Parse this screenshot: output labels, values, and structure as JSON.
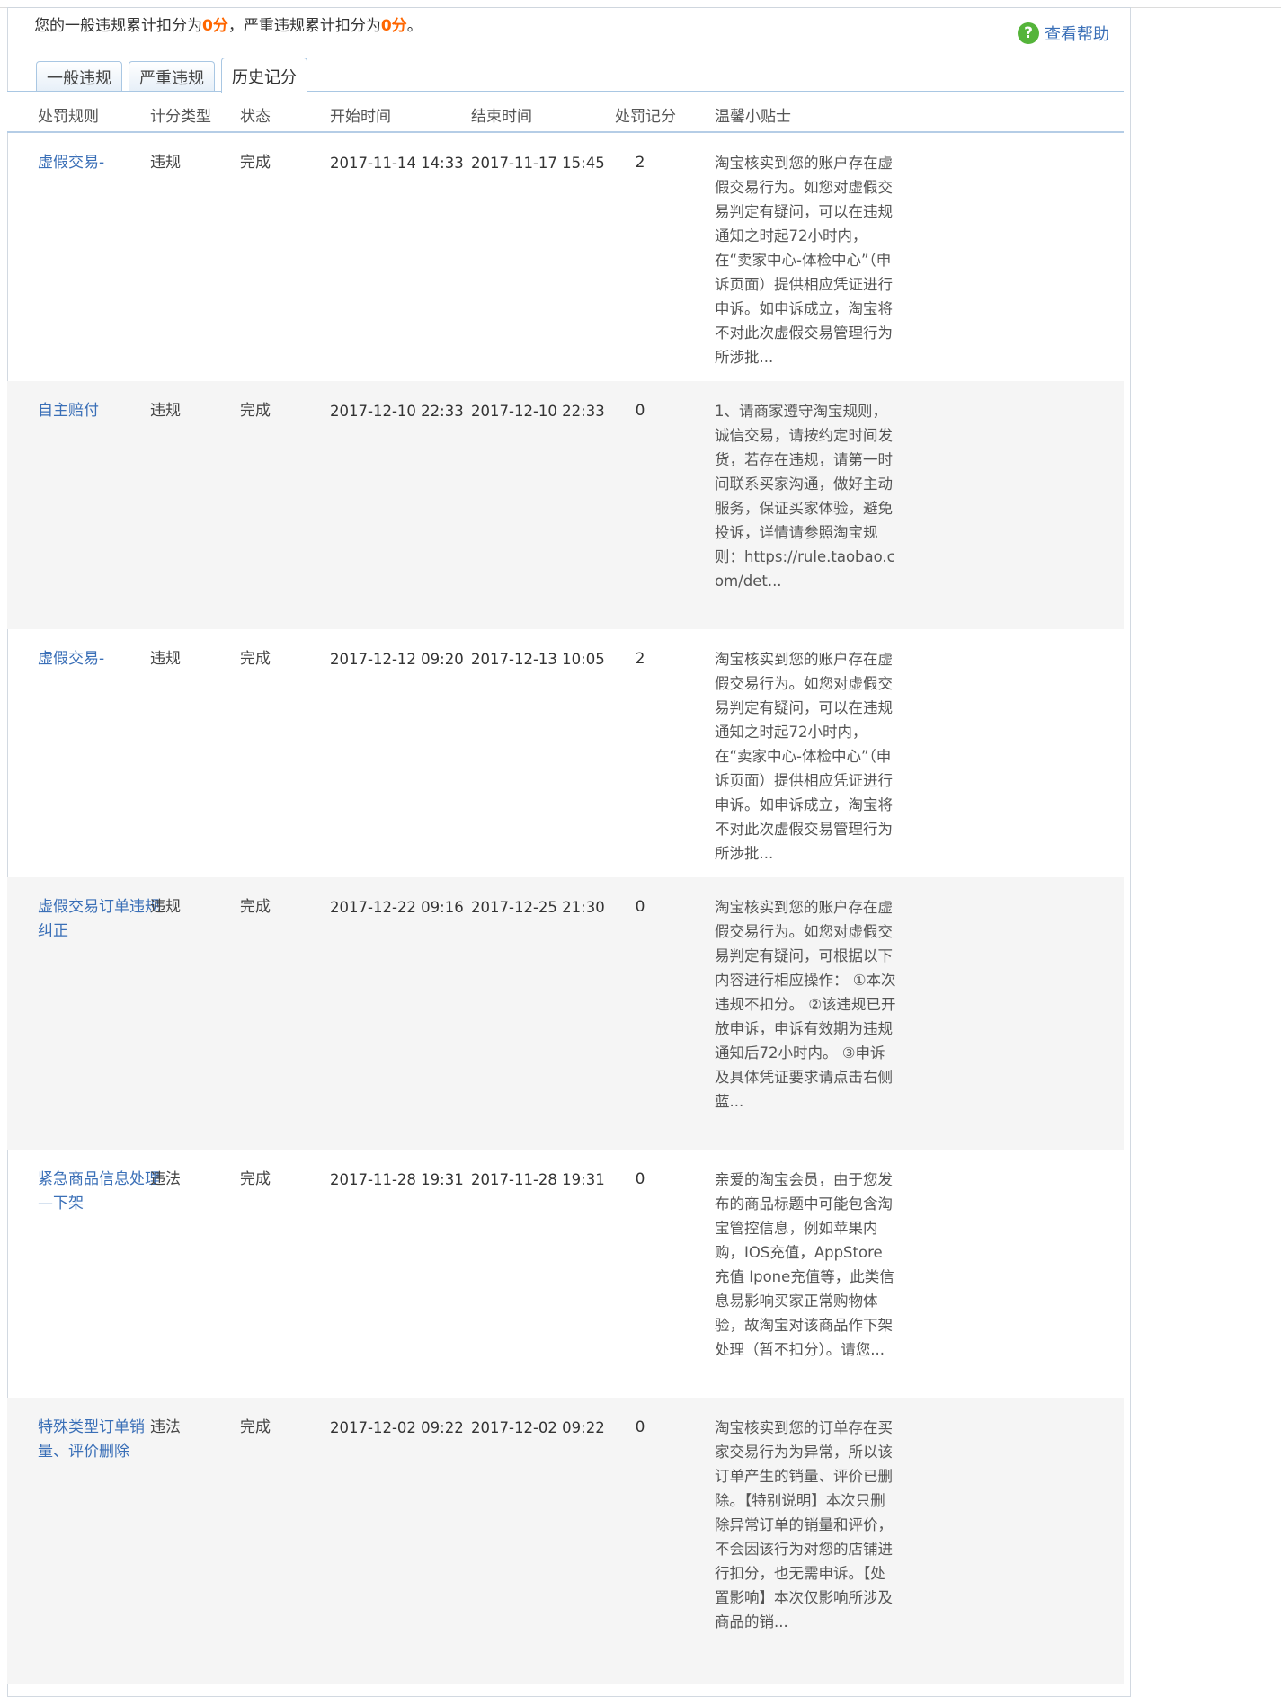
{
  "summary": {
    "prefix": "您的一般违规累计扣分为",
    "general_points": "0分",
    "middle": "，严重违规累计扣分为",
    "serious_points": "0分",
    "suffix": "。"
  },
  "help": {
    "label": "查看帮助",
    "icon": "help-question-icon",
    "icon_color": "#55b43a"
  },
  "tabs": [
    {
      "label": "一般违规",
      "active": false
    },
    {
      "label": "严重违规",
      "active": false
    },
    {
      "label": "历史记分",
      "active": true
    }
  ],
  "columns": [
    "处罚规则",
    "计分类型",
    "状态",
    "开始时间",
    "结束时间",
    "处罚记分",
    "温馨小贴士"
  ],
  "rows": [
    {
      "rule": "虚假交易-",
      "type": "违规",
      "status": "完成",
      "start": "2017-11-14 14:33",
      "end": "2017-11-17 15:45",
      "points": "2",
      "tip": "淘宝核实到您的账户存在虚假交易行为。如您对虚假交易判定有疑问，可以在违规通知之时起72小时内，在“卖家中心-体检中心”（申诉页面）提供相应凭证进行申诉。如申诉成立，淘宝将不对此次虚假交易管理行为所涉批..."
    },
    {
      "rule": "自主赔付",
      "type": "违规",
      "status": "完成",
      "start": "2017-12-10 22:33",
      "end": "2017-12-10 22:33",
      "points": "0",
      "tip": "1、请商家遵守淘宝规则，诚信交易，请按约定时间发货，若存在违规，请第一时间联系买家沟通，做好主动服务，保证买家体验，避免投诉，详情请参照淘宝规则：https://rule.taobao.com/det..."
    },
    {
      "rule": "虚假交易-",
      "type": "违规",
      "status": "完成",
      "start": "2017-12-12 09:20",
      "end": "2017-12-13 10:05",
      "points": "2",
      "tip": "淘宝核实到您的账户存在虚假交易行为。如您对虚假交易判定有疑问，可以在违规通知之时起72小时内，在“卖家中心-体检中心”（申诉页面）提供相应凭证进行申诉。如申诉成立，淘宝将不对此次虚假交易管理行为所涉批..."
    },
    {
      "rule": "虚假交易订单违规纠正",
      "type": "违规",
      "status": "完成",
      "start": "2017-12-22 09:16",
      "end": "2017-12-25 21:30",
      "points": "0",
      "tip": "淘宝核实到您的账户存在虚假交易行为。如您对虚假交易判定有疑问，可根据以下内容进行相应操作： ①本次违规不扣分。 ②该违规已开放申诉，申诉有效期为违规通知后72小时内。 ③申诉及具体凭证要求请点击右侧蓝..."
    },
    {
      "rule": "紧急商品信息处理—下架",
      "type": "违法",
      "status": "完成",
      "start": "2017-11-28 19:31",
      "end": "2017-11-28 19:31",
      "points": "0",
      "tip": "亲爱的淘宝会员，由于您发布的商品标题中可能包含淘宝管控信息，例如苹果内购，IOS充值，AppStore充值 Ipone充值等，此类信息易影响买家正常购物体验，故淘宝对该商品作下架处理（暂不扣分）。请您..."
    },
    {
      "rule": "特殊类型订单销量、评价删除",
      "type": "违法",
      "status": "完成",
      "start": "2017-12-02 09:22",
      "end": "2017-12-02 09:22",
      "points": "0",
      "tip": "淘宝核实到您的订单存在买家交易行为为异常，所以该订单产生的销量、评价已删除。【特别说明】本次只删除异常订单的销量和评价，不会因该行为对您的店铺进行扣分，也无需申诉。【处置影响】本次仅影响所涉及商品的销..."
    }
  ]
}
